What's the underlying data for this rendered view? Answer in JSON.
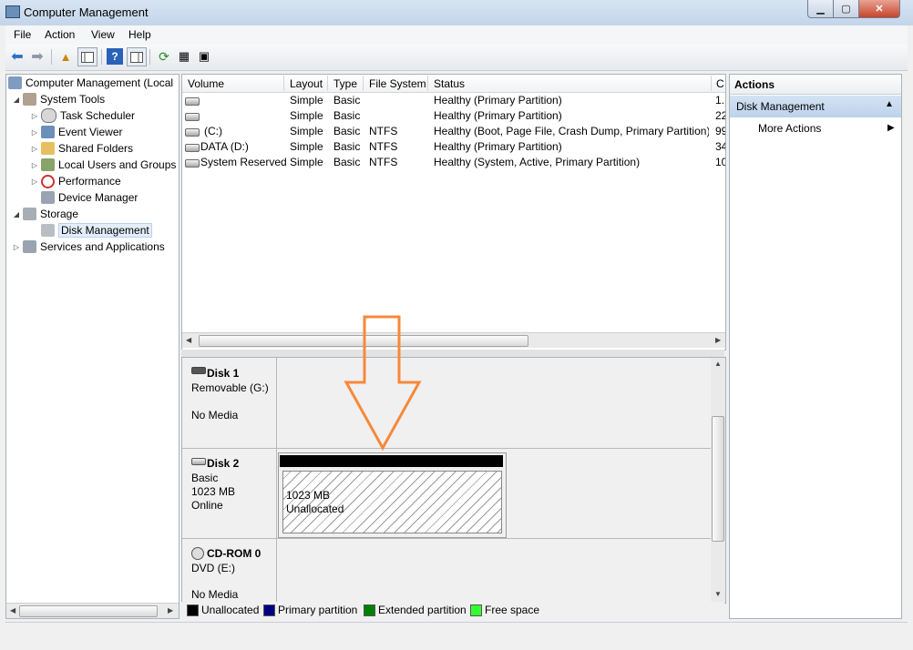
{
  "window": {
    "title": "Computer Management",
    "close_glyph": "✕",
    "min_glyph": "▁",
    "max_glyph": "▢"
  },
  "menu": [
    "File",
    "Action",
    "View",
    "Help"
  ],
  "tree": {
    "root": "Computer Management (Local",
    "system_tools": "System Tools",
    "items": [
      "Task Scheduler",
      "Event Viewer",
      "Shared Folders",
      "Local Users and Groups",
      "Performance",
      "Device Manager"
    ],
    "storage": "Storage",
    "disk_management": "Disk Management",
    "services": "Services and Applications"
  },
  "volume_list": {
    "columns": [
      "Volume",
      "Layout",
      "Type",
      "File System",
      "Status",
      "C"
    ],
    "rows": [
      {
        "volume": "",
        "layout": "Simple",
        "type": "Basic",
        "fs": "",
        "status": "Healthy (Primary Partition)",
        "cap": "1."
      },
      {
        "volume": "",
        "layout": "Simple",
        "type": "Basic",
        "fs": "",
        "status": "Healthy (Primary Partition)",
        "cap": "22"
      },
      {
        "volume": "(C:)",
        "layout": "Simple",
        "type": "Basic",
        "fs": "NTFS",
        "status": "Healthy (Boot, Page File, Crash Dump, Primary Partition)",
        "cap": "99"
      },
      {
        "volume": "DATA (D:)",
        "layout": "Simple",
        "type": "Basic",
        "fs": "NTFS",
        "status": "Healthy (Primary Partition)",
        "cap": "34"
      },
      {
        "volume": "System Reserved",
        "layout": "Simple",
        "type": "Basic",
        "fs": "NTFS",
        "status": "Healthy (System, Active, Primary Partition)",
        "cap": "10"
      }
    ]
  },
  "disks": {
    "disk1": {
      "name": "Disk 1",
      "line2": "Removable (G:)",
      "line3": "No Media"
    },
    "disk2": {
      "name": "Disk 2",
      "line2": "Basic",
      "line3": "1023 MB",
      "line4": "Online",
      "part_size": "1023 MB",
      "part_state": "Unallocated"
    },
    "cdrom": {
      "name": "CD-ROM 0",
      "line2": "DVD (E:)",
      "line3": "No Media"
    }
  },
  "legend": [
    {
      "label": "Unallocated",
      "color": "#000000"
    },
    {
      "label": "Primary partition",
      "color": "#000080"
    },
    {
      "label": "Extended partition",
      "color": "#008000"
    },
    {
      "label": "Free space",
      "color": "#33ff33"
    }
  ],
  "actions": {
    "header": "Actions",
    "section": "Disk Management",
    "item": "More Actions"
  },
  "colors": {
    "annotation_arrow": "#f7883b"
  }
}
